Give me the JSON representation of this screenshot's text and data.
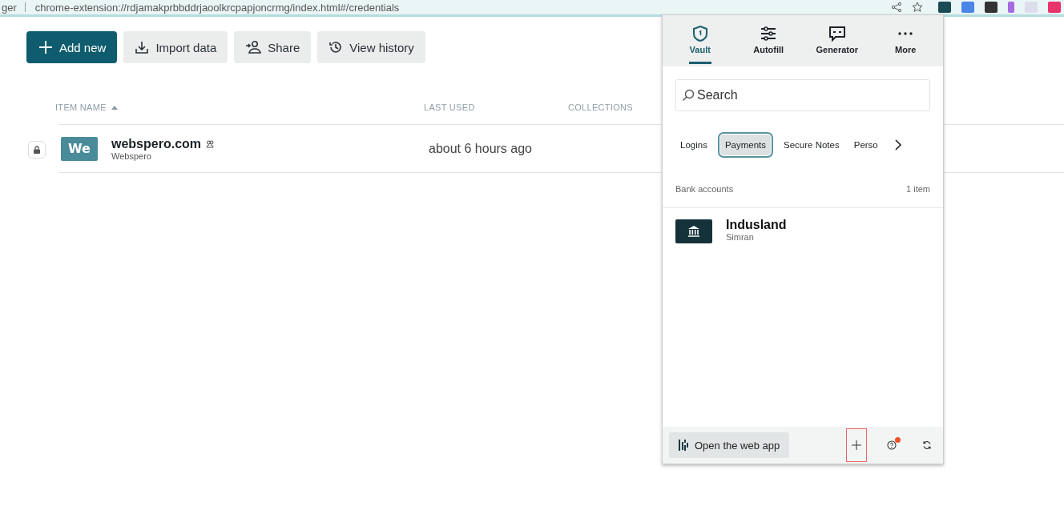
{
  "browser": {
    "tab_fragment": "ger",
    "url": "chrome-extension://rdjamakprbbddrjaoolkrcpapjoncrmg/index.html#/credentials"
  },
  "toolbar": [
    {
      "label": "Add new",
      "kind": "primary"
    },
    {
      "label": "Import data",
      "kind": "secondary"
    },
    {
      "label": "Share",
      "kind": "secondary"
    },
    {
      "label": "View history",
      "kind": "secondary"
    }
  ],
  "table": {
    "columns": [
      {
        "label": "ITEM NAME",
        "sorted": true
      },
      {
        "label": "LAST USED",
        "sorted": false
      },
      {
        "label": "COLLECTIONS",
        "sorted": false
      }
    ],
    "rows": [
      {
        "locked": true,
        "initials": "We",
        "title": "webspero.com",
        "shared": true,
        "subtitle": "Webspero",
        "last_used": "about 6 hours ago"
      }
    ]
  },
  "popup": {
    "nav": [
      {
        "label": "Vault",
        "selected": true
      },
      {
        "label": "Autofill",
        "selected": false
      },
      {
        "label": "Generator",
        "selected": false
      },
      {
        "label": "More",
        "selected": false
      }
    ],
    "search": {
      "placeholder": "Search"
    },
    "filters": [
      {
        "label": "Logins",
        "selected": false
      },
      {
        "label": "Payments",
        "selected": true
      },
      {
        "label": "Secure Notes",
        "selected": false
      },
      {
        "label": "Perso",
        "selected": false
      }
    ],
    "section": {
      "title": "Bank accounts",
      "count": "1 item"
    },
    "items": [
      {
        "title": "Indusland",
        "subtitle": "Simran"
      }
    ],
    "footer": {
      "open_label": "Open the web app",
      "add_highlighted": true,
      "help_badge": true
    }
  }
}
